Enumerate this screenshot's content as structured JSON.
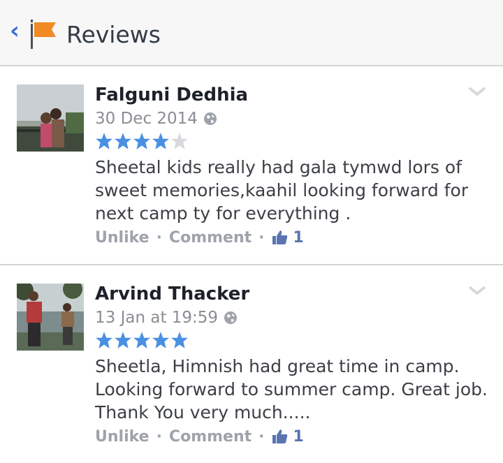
{
  "header": {
    "title": "Reviews",
    "back_icon": "chevron-left-icon",
    "app_icon": "flag-icon",
    "accent": "#f08a24"
  },
  "reviews": [
    {
      "author": "Falguni Dedhia",
      "date": "30 Dec 2014",
      "privacy_icon": "globe-icon",
      "rating": 4,
      "max_rating": 5,
      "text": "Sheetal kids really had gala tymwd lors of sweet memories,kaahil looking forward for next camp ty for everything  .",
      "actions": {
        "unlike": "Unlike",
        "separator": "·",
        "comment": "Comment",
        "like_count": "1"
      }
    },
    {
      "author": "Arvind Thacker",
      "date": "13 Jan at 19:59",
      "privacy_icon": "globe-icon",
      "rating": 5,
      "max_rating": 5,
      "text": "Sheetla, Himnish had great time in camp. Looking forward to summer camp. Great job. Thank You very much.....",
      "actions": {
        "unlike": "Unlike",
        "separator": "·",
        "comment": "Comment",
        "like_count": "1"
      }
    }
  ],
  "colors": {
    "star_filled": "#4a90e2",
    "star_empty": "#d7d9dc",
    "like_blue": "#5a74b1"
  }
}
